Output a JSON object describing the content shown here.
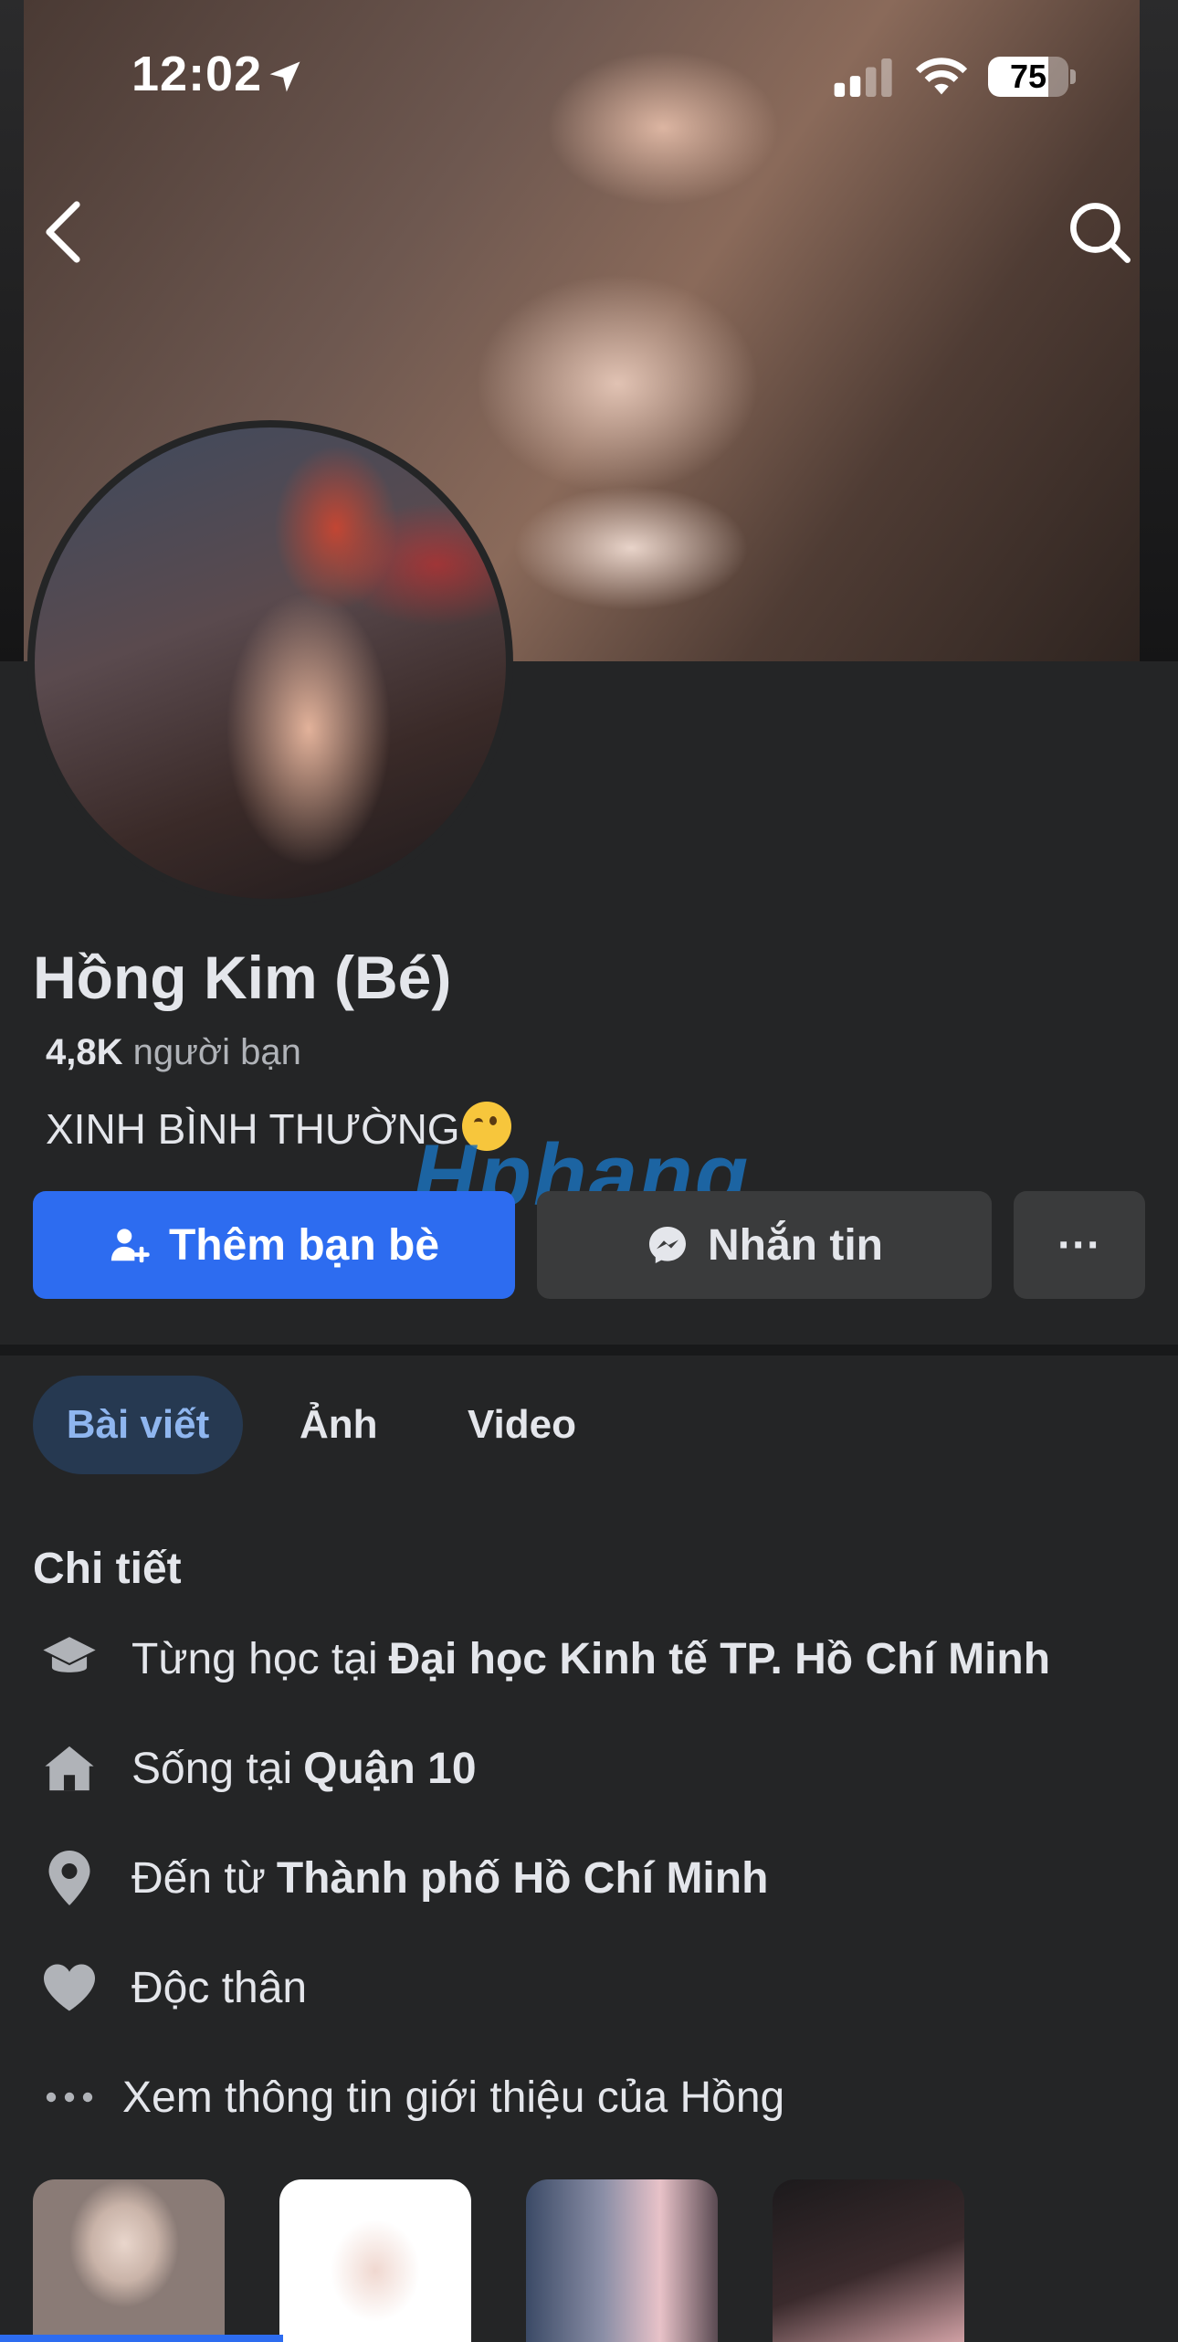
{
  "status_bar": {
    "time": "12:02",
    "battery": "75",
    "battery_level": 0.75
  },
  "profile": {
    "name": "Hồng Kim (Bé)",
    "friends_count": "4,8K",
    "friends_label": "người bạn",
    "bio": "XINH BÌNH THƯỜNG"
  },
  "watermark": {
    "part1": "Hp",
    "part2": "hang"
  },
  "actions": {
    "add_friend": "Thêm bạn bè",
    "message": "Nhắn tin",
    "more": "···"
  },
  "tabs": [
    {
      "label": "Bài viết",
      "active": true
    },
    {
      "label": "Ảnh",
      "active": false
    },
    {
      "label": "Video",
      "active": false
    }
  ],
  "details": {
    "title": "Chi tiết",
    "items": [
      {
        "icon": "graduation-cap-icon",
        "prefix": "Từng học tại",
        "value": "Đại học Kinh tế TP. Hồ Chí Minh"
      },
      {
        "icon": "home-icon",
        "prefix": "Sống tại",
        "value": "Quận 10"
      },
      {
        "icon": "location-pin-icon",
        "prefix": "Đến từ",
        "value": "Thành phố Hồ Chí Minh"
      },
      {
        "icon": "heart-icon",
        "prefix": "Độc thân",
        "value": ""
      },
      {
        "icon": "ellipsis-icon",
        "prefix": "Xem thông tin giới thiệu của Hồng",
        "value": ""
      }
    ]
  },
  "colors": {
    "background": "#242526",
    "primary_button": "#2d6cf0",
    "secondary_button": "#3a3b3c",
    "active_tab_bg": "#263951",
    "active_tab_text": "#8fb6ef"
  }
}
